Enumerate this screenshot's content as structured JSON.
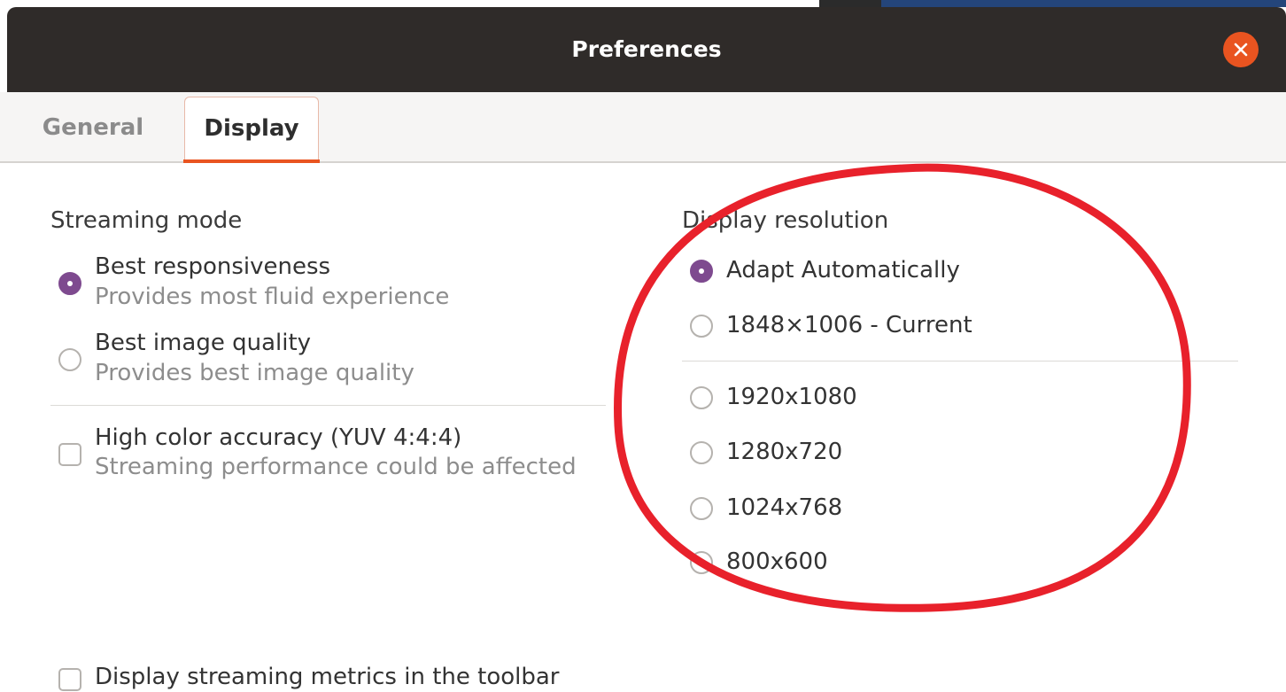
{
  "window": {
    "title": "Preferences"
  },
  "tabs": [
    {
      "label": "General",
      "active": false
    },
    {
      "label": "Display",
      "active": true
    }
  ],
  "streaming": {
    "title": "Streaming mode",
    "options": [
      {
        "label": "Best responsiveness",
        "description": "Provides most fluid experience",
        "selected": true
      },
      {
        "label": "Best image quality",
        "description": "Provides best image quality",
        "selected": false
      }
    ],
    "color_accuracy": {
      "label": "High color accuracy (YUV 4:4:4)",
      "description": "Streaming performance could be affected",
      "checked": false
    }
  },
  "resolution": {
    "title": "Display resolution",
    "options": [
      {
        "label": "Adapt Automatically",
        "selected": true
      },
      {
        "label": "1848×1006 - Current",
        "selected": false
      },
      {
        "label": "1920x1080",
        "selected": false
      },
      {
        "label": "1280x720",
        "selected": false
      },
      {
        "label": "1024x768",
        "selected": false
      },
      {
        "label": "800x600",
        "selected": false
      }
    ]
  },
  "metrics": {
    "label": "Display streaming metrics in the toolbar",
    "checked": false
  },
  "colors": {
    "accent": "#e95420",
    "radio_selected": "#7e4a8f",
    "highlight_circle": "#e8212b",
    "titlebar": "#2f2b29"
  }
}
